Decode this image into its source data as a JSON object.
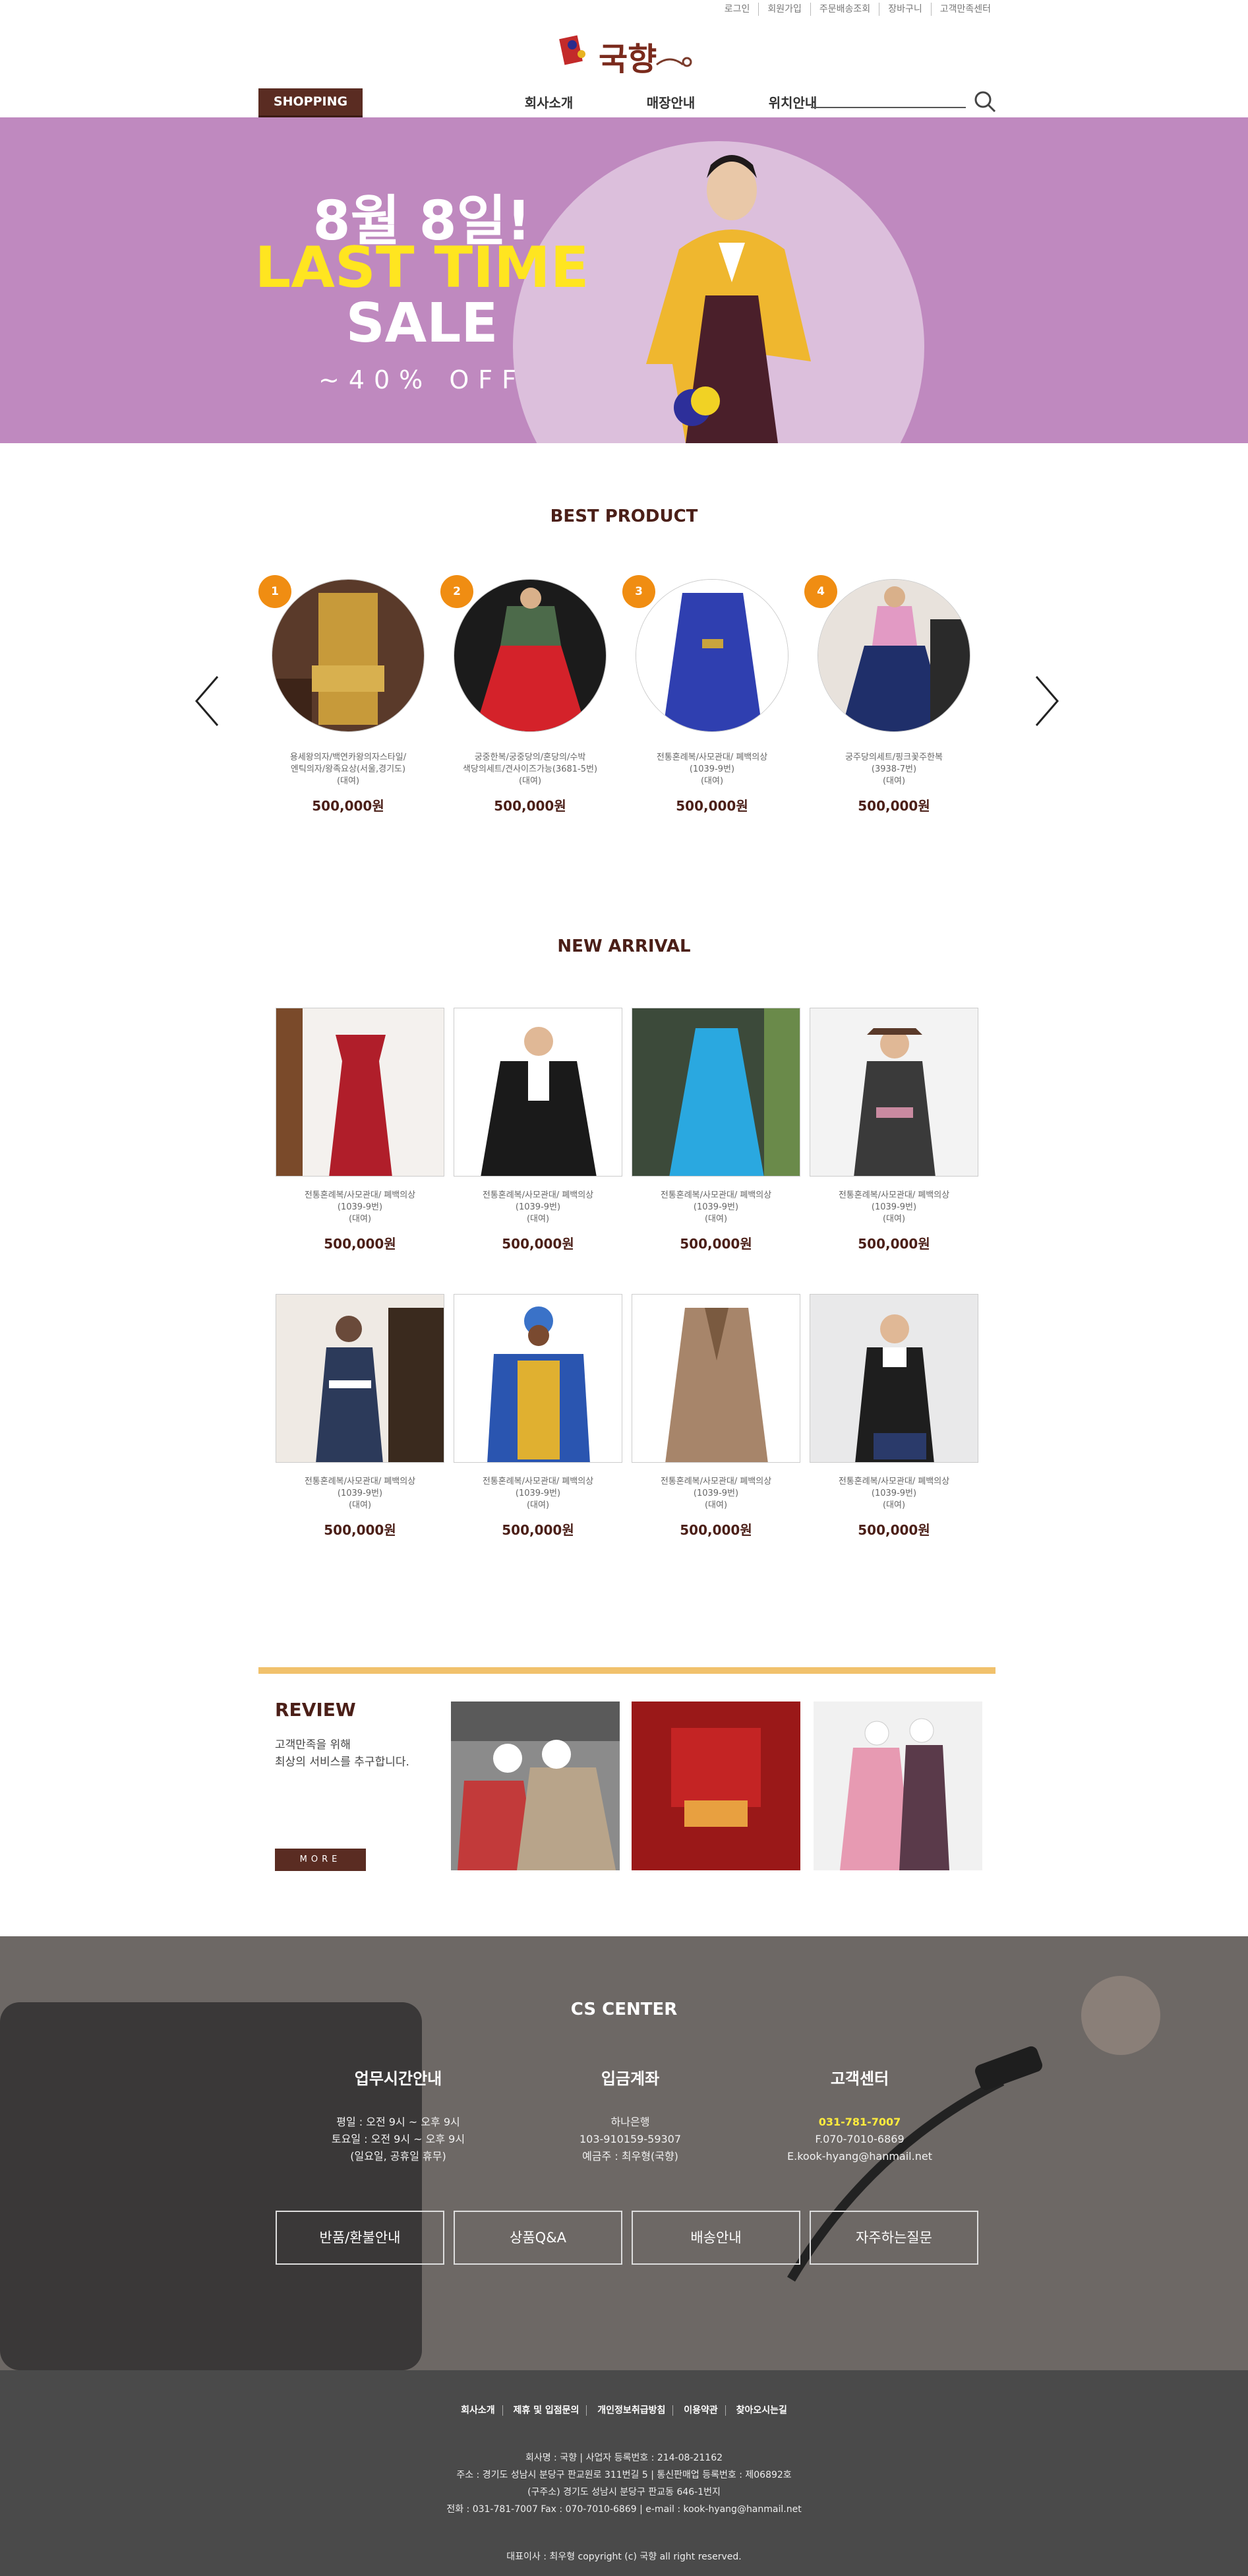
{
  "header": {
    "top_links": [
      "로그인",
      "회원가입",
      "주문배송조회",
      "장바구니",
      "고객만족센터"
    ],
    "logo_text": "국향",
    "shop_label": "SHOPPING",
    "nav": [
      "회사소개",
      "매장안내",
      "위치안내"
    ]
  },
  "banner": {
    "line1": "8월 8일!",
    "line2": "LAST TIME",
    "line3": "SALE",
    "line4": "~40% OFF"
  },
  "best": {
    "title": "BEST PRODUCT",
    "items": [
      {
        "rank": "1",
        "desc1": "용세왕의자/백연카왕의자스타일/",
        "desc2": "엔틱의자/왕족요상(서울,경기도)",
        "desc3": "(대여)",
        "price": "500,000원"
      },
      {
        "rank": "2",
        "desc1": "궁중한복/궁중당의/혼당의/수박",
        "desc2": "색당의세트/견사이즈가능(3681-5번)",
        "desc3": "(대여)",
        "price": "500,000원"
      },
      {
        "rank": "3",
        "desc1": "전통혼례복/사모관대/ 폐백의상",
        "desc2": "(1039-9번)",
        "desc3": "(대여)",
        "price": "500,000원"
      },
      {
        "rank": "4",
        "desc1": "궁주당의세트/핑크꽃주한복",
        "desc2": "(3938-7번)",
        "desc3": "(대여)",
        "price": "500,000원"
      }
    ]
  },
  "arrival": {
    "title": "NEW ARRIVAL",
    "items": [
      {
        "desc1": "전통혼례복/사모관대/ 폐백의상",
        "desc2": "(1039-9번)",
        "desc3": "(대여)",
        "price": "500,000원"
      },
      {
        "desc1": "전통혼례복/사모관대/ 폐백의상",
        "desc2": "(1039-9번)",
        "desc3": "(대여)",
        "price": "500,000원"
      },
      {
        "desc1": "전통혼례복/사모관대/ 폐백의상",
        "desc2": "(1039-9번)",
        "desc3": "(대여)",
        "price": "500,000원"
      },
      {
        "desc1": "전통혼례복/사모관대/ 폐백의상",
        "desc2": "(1039-9번)",
        "desc3": "(대여)",
        "price": "500,000원"
      },
      {
        "desc1": "전통혼례복/사모관대/ 폐백의상",
        "desc2": "(1039-9번)",
        "desc3": "(대여)",
        "price": "500,000원"
      },
      {
        "desc1": "전통혼례복/사모관대/ 폐백의상",
        "desc2": "(1039-9번)",
        "desc3": "(대여)",
        "price": "500,000원"
      },
      {
        "desc1": "전통혼례복/사모관대/ 폐백의상",
        "desc2": "(1039-9번)",
        "desc3": "(대여)",
        "price": "500,000원"
      },
      {
        "desc1": "전통혼례복/사모관대/ 폐백의상",
        "desc2": "(1039-9번)",
        "desc3": "(대여)",
        "price": "500,000원"
      }
    ]
  },
  "review": {
    "title": "REVIEW",
    "text1": "고객만족을 위해",
    "text2": "최상의 서비스를 추구합니다.",
    "more": "MORE"
  },
  "cs": {
    "title": "CS CENTER",
    "hours": {
      "heading": "업무시간안내",
      "l1": "평일 : 오전 9시 ~ 오후 9시",
      "l2": "토요일 : 오전 9시 ~ 오후 9시",
      "l3": "(일요일, 공휴일 휴무)"
    },
    "account": {
      "heading": "입금계좌",
      "l1": "하나은행",
      "l2": "103-910159-59307",
      "l3": "예금주 : 최우형(국향)"
    },
    "center": {
      "heading": "고객센터",
      "l1": "031-781-7007",
      "l2": "F.070-7010-6869",
      "l3": "E.kook-hyang@hanmail.net"
    },
    "buttons": [
      "반품/환불안내",
      "상품Q&A",
      "배송안내",
      "자주하는질문"
    ]
  },
  "footer": {
    "links": [
      "회사소개",
      "제휴 및 입점문의",
      "개인정보취급방침",
      "이용약관",
      "찾아오시는길"
    ],
    "info1": "회사명 : 국향 | 사업자 등록번호 : 214-08-21162",
    "info2": "주소 : 경기도 성남시 분당구 판교원로 311번길 5 | 통신판매업 등록번호 : 제06892호",
    "info3": "(구주소) 경기도 성남시 분당구 판교동 646-1번지",
    "info4": "전화 : 031-781-7007 Fax : 070-7010-6869 | e-mail : kook-hyang@hanmail.net",
    "copyright": "대표이사 : 최우형 copyright (c) 국향 all right reserved."
  },
  "colors": {
    "brand": "#5a2c22",
    "banner": "#bf89bf",
    "badge": "#f08d12",
    "accent": "#f1c16c"
  }
}
